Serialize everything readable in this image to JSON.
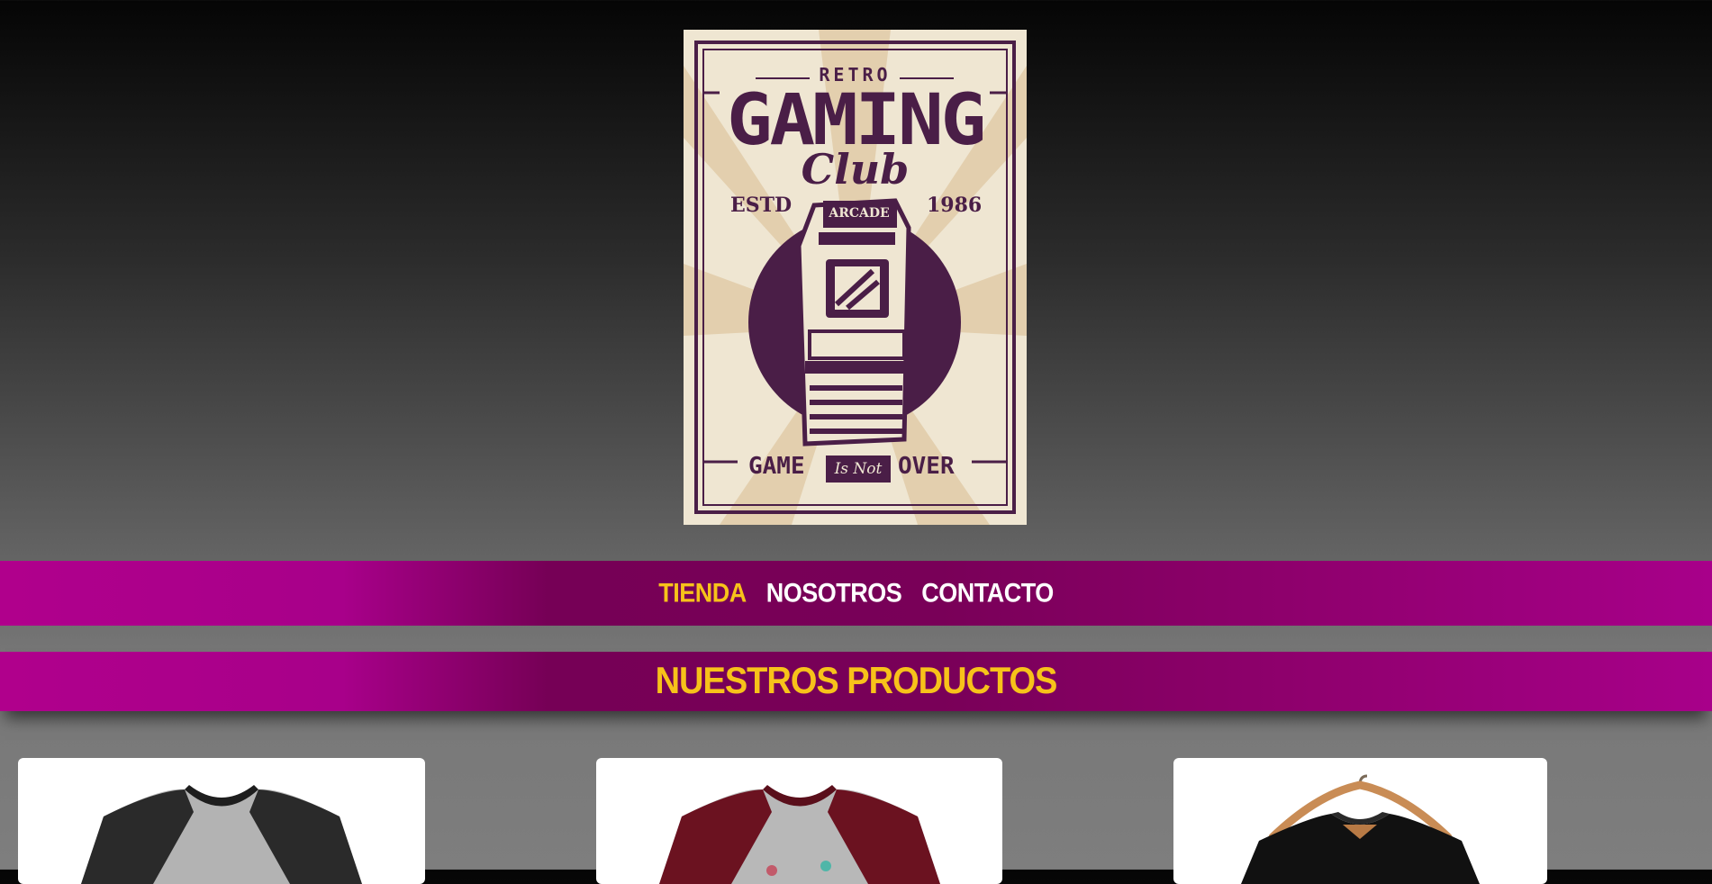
{
  "poster": {
    "top": "RETRO",
    "title": "GAMING",
    "subtitle": "Club",
    "estd_label": "ESTD",
    "year": "1986",
    "arcade_label": "ARCADE",
    "bottom_left": "GAME",
    "bottom_mid": "Is Not",
    "bottom_right": "OVER"
  },
  "nav": {
    "items": [
      {
        "label": "TIENDA",
        "active": true
      },
      {
        "label": "NOSOTROS",
        "active": false
      },
      {
        "label": "CONTACTO",
        "active": false
      }
    ]
  },
  "products_section": {
    "title": "NUESTROS PRODUCTOS"
  },
  "products": [
    {
      "image": "black-sleeve-raglan-shirt"
    },
    {
      "image": "maroon-sleeve-raglan-shirt"
    },
    {
      "image": "black-shirt-on-hanger"
    }
  ],
  "colors": {
    "band": "#a8008a",
    "accent": "#f7c21a",
    "poster_ink": "#4a1e47",
    "poster_paper": "#efe6d2"
  }
}
